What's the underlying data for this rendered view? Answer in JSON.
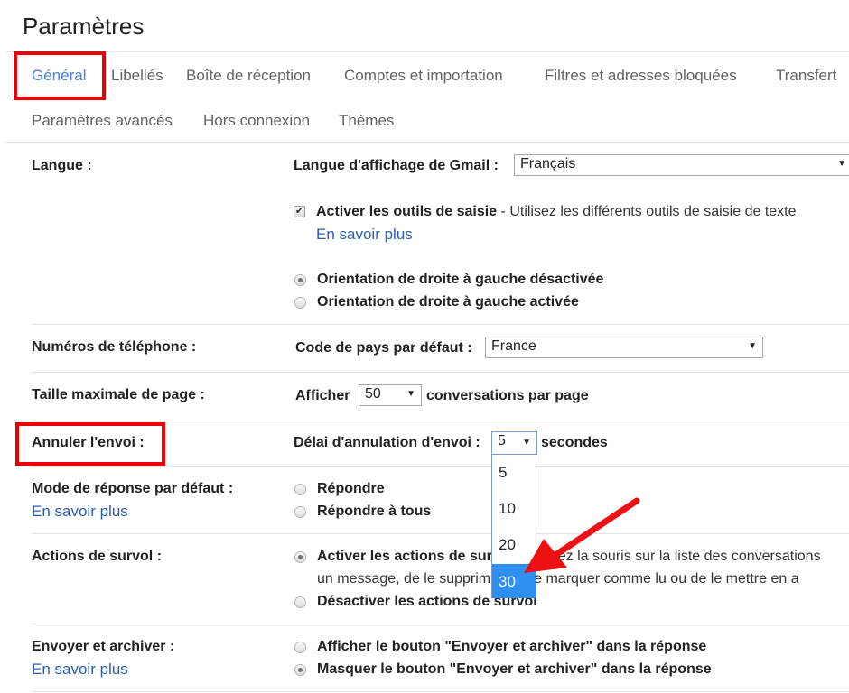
{
  "page": {
    "title": "Paramètres"
  },
  "tabs": [
    {
      "label": "Général",
      "active": true
    },
    {
      "label": "Libellés"
    },
    {
      "label": "Boîte de réception"
    },
    {
      "label": "Comptes et importation"
    },
    {
      "label": "Filtres et adresses bloquées"
    },
    {
      "label": "Transfert"
    },
    {
      "label": "Paramètres avancés"
    },
    {
      "label": "Hors connexion"
    },
    {
      "label": "Thèmes"
    }
  ],
  "settings": {
    "langue": {
      "label": "Langue :",
      "display_label": "Langue d'affichage de Gmail :",
      "display_value": "Français",
      "input_tools_checked": true,
      "input_tools_bold": "Activer les outils de saisie",
      "input_tools_desc": " - Utilisez les différents outils de saisie de texte",
      "learn_more": "En savoir plus",
      "rtl_options": [
        {
          "label": "Orientation de droite à gauche désactivée",
          "selected": true
        },
        {
          "label": "Orientation de droite à gauche activée",
          "selected": false
        }
      ]
    },
    "phone": {
      "label": "Numéros de téléphone :",
      "country_label": "Code de pays par défaut :",
      "country_value": "France"
    },
    "page_size": {
      "label": "Taille maximale de page :",
      "prefix": "Afficher",
      "value": "50",
      "suffix": "conversations par page"
    },
    "undo_send": {
      "label": "Annuler l'envoi :",
      "delay_label": "Délai d'annulation d'envoi :",
      "value": "5",
      "suffix": "secondes",
      "options": [
        "5",
        "10",
        "20",
        "30"
      ],
      "highlighted_option": "30"
    },
    "reply_mode": {
      "label": "Mode de réponse par défaut :",
      "learn_more": "En savoir plus",
      "options": [
        {
          "label": "Répondre",
          "selected": false
        },
        {
          "label": "Répondre à tous",
          "selected": false
        }
      ]
    },
    "hover_actions": {
      "label": "Actions de survol :",
      "enable_bold": "Activer les actions de survol",
      "enable_desc_line1": " - Passez la souris sur la liste des conversations",
      "enable_desc_line2": "un message, de le supprimer, de le marquer comme lu ou de le mettre en a",
      "enable_selected": true,
      "disable_label": "Désactiver les actions de survol",
      "disable_selected": false
    },
    "send_archive": {
      "label": "Envoyer et archiver :",
      "learn_more": "En savoir plus",
      "options": [
        {
          "label": "Afficher le bouton \"Envoyer et archiver\" dans la réponse",
          "selected": false
        },
        {
          "label": "Masquer le bouton \"Envoyer et archiver\" dans la réponse",
          "selected": true
        }
      ]
    }
  },
  "colors": {
    "accent": "#4a7fd4",
    "link": "#2a5db0",
    "highlight_box": "#ee0000",
    "option_hover": "#2f8ff0"
  }
}
